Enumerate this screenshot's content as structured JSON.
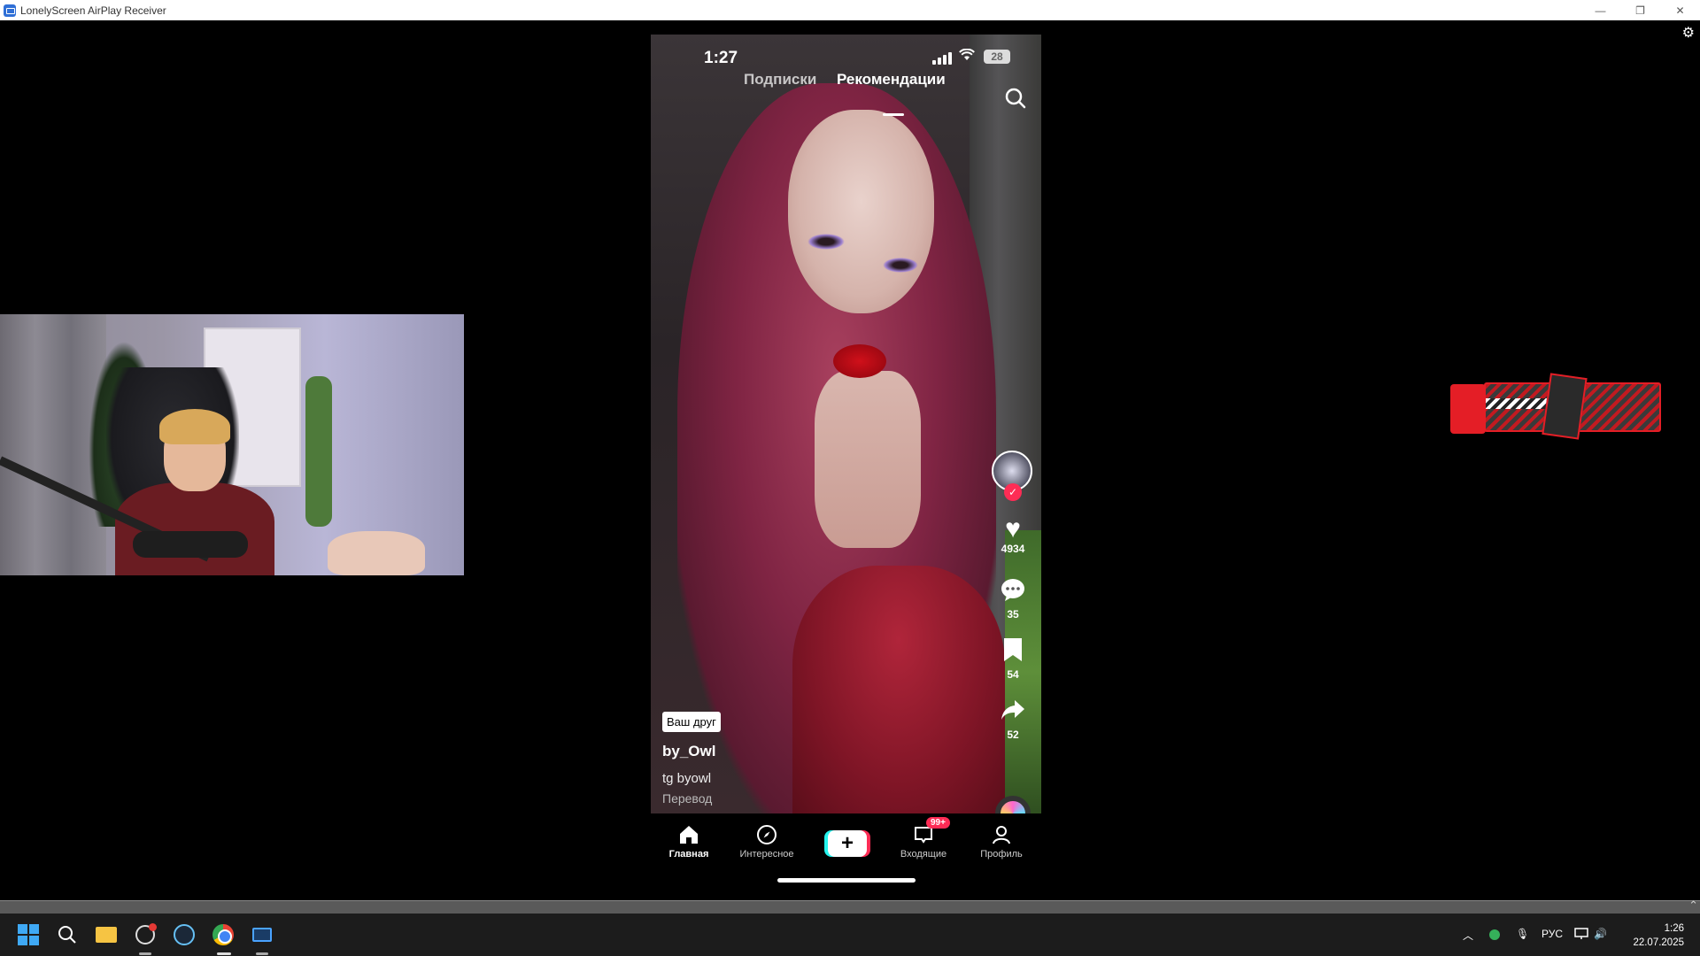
{
  "window": {
    "title": "LonelyScreen AirPlay Receiver",
    "controls": {
      "minimize": "—",
      "restore": "❐",
      "close": "✕"
    },
    "settings_icon": "⚙"
  },
  "phone": {
    "status": {
      "time": "1:27",
      "battery": "28"
    },
    "tabs": {
      "following": "Подписки",
      "for_you": "Рекомендации"
    },
    "actions": {
      "likes": "4934",
      "comments": "35",
      "saves": "54",
      "shares": "52"
    },
    "caption": {
      "badge": "Ваш друг",
      "username": "by_Owl",
      "description": "tg byowl",
      "translate": "Перевод"
    },
    "nav": {
      "home": "Главная",
      "discover": "Интересное",
      "create": "+",
      "inbox": "Входящие",
      "inbox_badge": "99+",
      "profile": "Профиль"
    }
  },
  "taskbar": {
    "language": "РУС",
    "time": "1:26",
    "date": "22.07.2025"
  }
}
